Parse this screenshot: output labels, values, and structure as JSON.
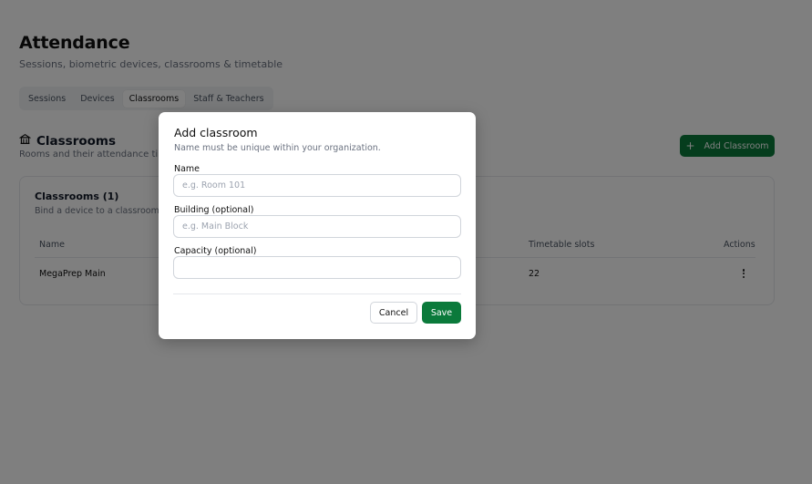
{
  "header": {
    "title": "Attendance",
    "subtitle": "Sessions, biometric devices, classrooms & timetable"
  },
  "tabs": [
    {
      "label": "Sessions",
      "active": false
    },
    {
      "label": "Devices",
      "active": false
    },
    {
      "label": "Classrooms",
      "active": true
    },
    {
      "label": "Staff & Teachers",
      "active": false
    }
  ],
  "section": {
    "icon": "building-columns-icon",
    "title": "Classrooms",
    "subtitle": "Rooms and their attendance timeta"
  },
  "add_button": {
    "icon": "plus-icon",
    "label": "Add Classroom"
  },
  "card": {
    "title": "Classrooms (1)",
    "subtitle": "Bind a device to a classroom, the",
    "columns": {
      "name": "Name",
      "timetable_slots": "Timetable slots",
      "actions": "Actions"
    },
    "rows": [
      {
        "name": "MegaPrep Main",
        "timetable_slots": "22",
        "actions_icon": "kebab-menu-icon"
      }
    ]
  },
  "modal": {
    "title": "Add classroom",
    "subtitle": "Name must be unique within your organization.",
    "fields": {
      "name": {
        "label": "Name",
        "value": "",
        "placeholder": "e.g. Room 101"
      },
      "building": {
        "label": "Building (optional)",
        "value": "",
        "placeholder": "e.g. Main Block"
      },
      "capacity": {
        "label": "Capacity (optional)",
        "value": "",
        "placeholder": ""
      }
    },
    "cancel_label": "Cancel",
    "save_label": "Save"
  },
  "colors": {
    "accent": "#0b7a3b",
    "overlay": "rgba(0,0,0,0.5)"
  }
}
